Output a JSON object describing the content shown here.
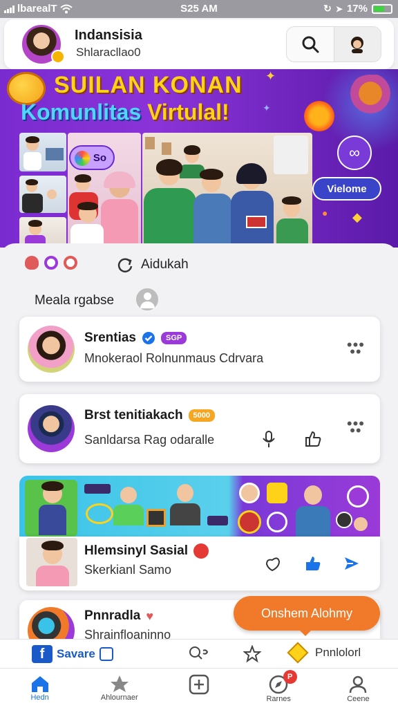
{
  "status_bar": {
    "carrier": "lbarealT",
    "time": "S25 AM",
    "battery_pct": "17%"
  },
  "header": {
    "title": "Indansisia",
    "subtitle": "Shlaracllao0",
    "search_icon": "search-icon",
    "profile_icon": "profile-icon"
  },
  "banner": {
    "title_line1": "SUILAN KONAN",
    "title_line2_a": "Komunlitas ",
    "title_line2_b": "Virtulal!",
    "so_button": "So",
    "welcome_button": "Vielome"
  },
  "feed_header": {
    "action_label": "Aidukah"
  },
  "section": {
    "label": "Meala rgabse"
  },
  "posts": [
    {
      "title": "Srentias",
      "badge": "SGP",
      "subtitle": "Mnokeraol Rolnunmaus Cdrvara",
      "verified": true
    },
    {
      "title": "Brst tenitiakach",
      "badge": "5000",
      "subtitle": "Sanldarsa Rag odaralle"
    },
    {
      "title": "Hlemsinyl Sasial",
      "subtitle": "Skerkianl Samo"
    },
    {
      "title": "Pnnradla",
      "subtitle": "Shrainfloaninno"
    }
  ],
  "fab": {
    "label": "Onshem Alohmy"
  },
  "sub_bar": {
    "brand": "Savare",
    "right_label": "Pnnlolorl"
  },
  "nav": [
    {
      "label": "Hedn",
      "icon": "home-icon",
      "active": true
    },
    {
      "label": "Ahlournaer",
      "icon": "star-icon"
    },
    {
      "label": "",
      "icon": "add-icon"
    },
    {
      "label": "Rarnes",
      "icon": "compass-icon",
      "badge": "P"
    },
    {
      "label": "Ceene",
      "icon": "user-icon"
    }
  ],
  "colors": {
    "accent": "#1a73e8",
    "banner_purple": "#7a2bd0",
    "fab_orange": "#f07a2a",
    "badge_purple": "#9b3ad8",
    "badge_orange": "#f5a623"
  }
}
